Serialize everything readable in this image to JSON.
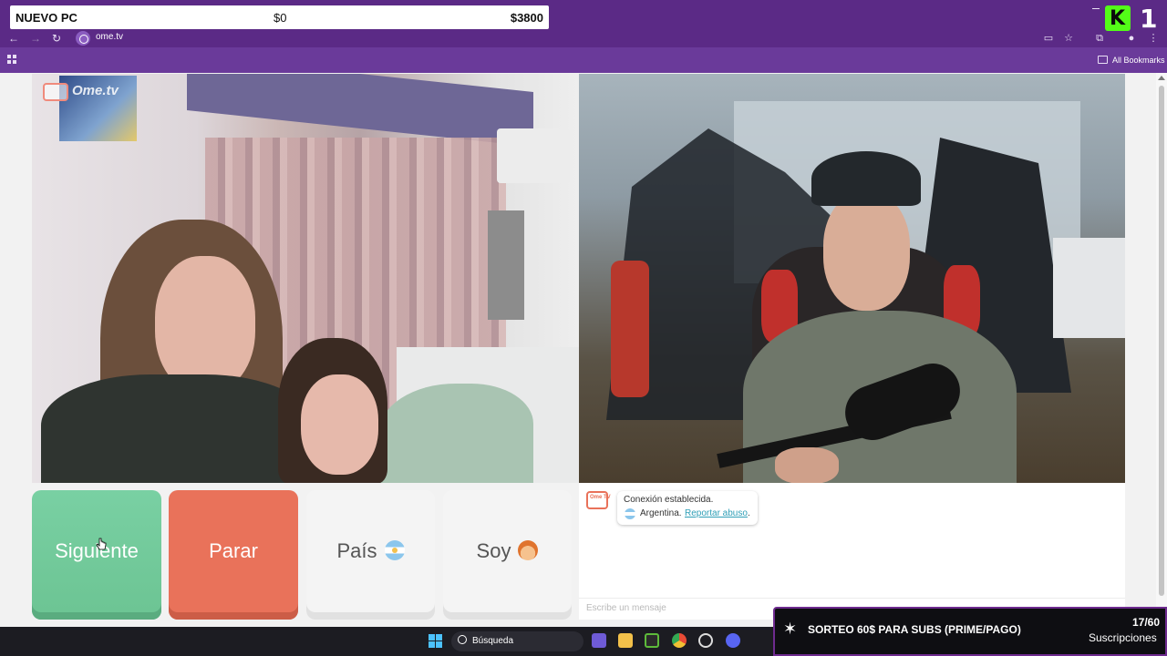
{
  "goal_overlay": {
    "title": "NUEVO PC",
    "current": "$0",
    "target": "$3800"
  },
  "browser": {
    "url": "ome.tv",
    "bookmarks_label": "All Bookmarks"
  },
  "video": {
    "watermark": "Ome.tv"
  },
  "controls": {
    "next_label": "Siguiente",
    "stop_label": "Parar",
    "country_label": "País",
    "gender_label": "Soy"
  },
  "chat": {
    "logo_text": "Ome TV",
    "status": "Conexión establecida.",
    "country": "Argentina.",
    "report_link": "Reportar abuso",
    "report_suffix": ".",
    "input_placeholder": "Escribe un mensaje"
  },
  "taskbar": {
    "search_label": "Búsqueda"
  },
  "sub_goal": {
    "title": "SORTEO 60$ PARA SUBS (PRIME/PAGO)",
    "count": "17/60",
    "label": "Suscripciones"
  },
  "colors": {
    "browser_frame": "#5b2a86",
    "next_button": "#79d0a3",
    "stop_button": "#e9725a",
    "link": "#2f9fb7",
    "kick_green": "#53fc18"
  }
}
